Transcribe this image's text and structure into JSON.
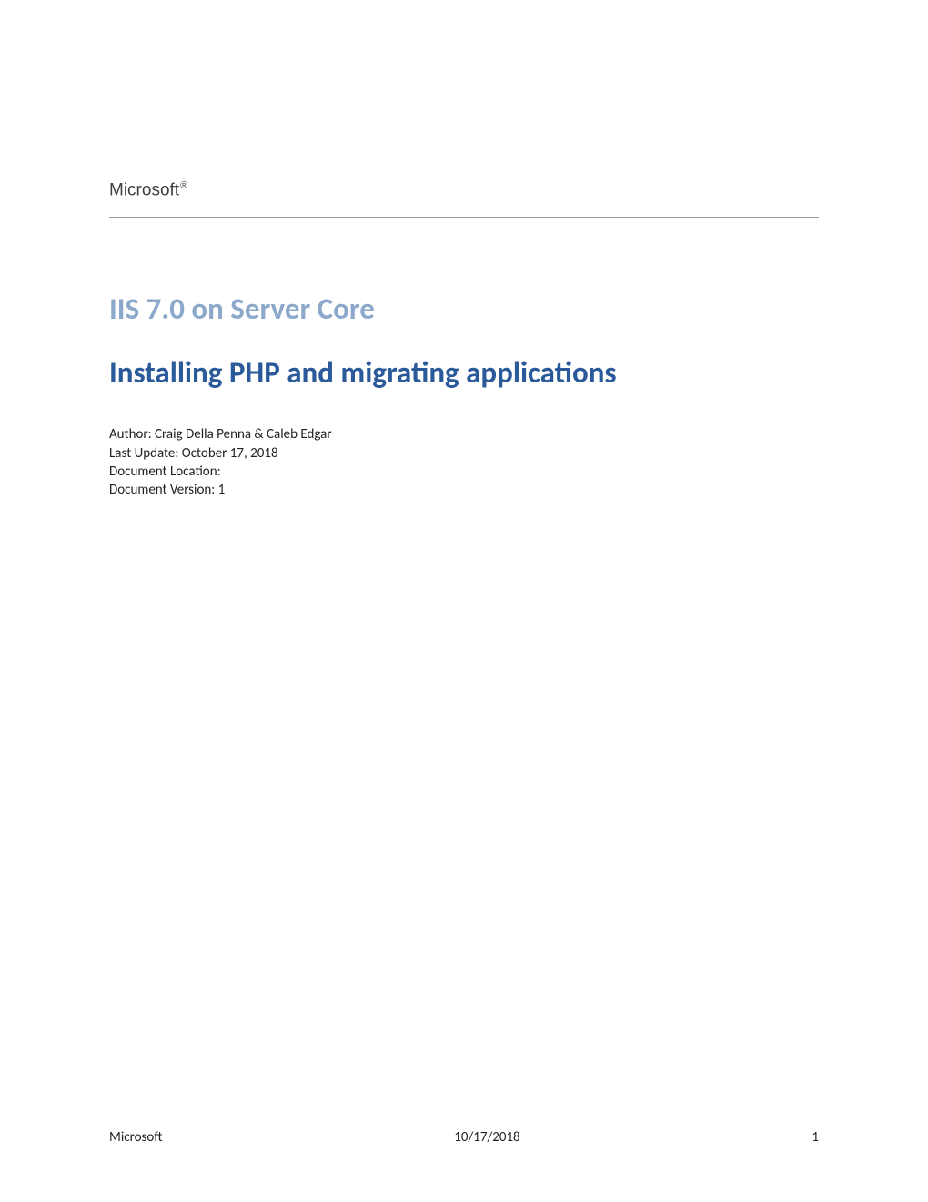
{
  "header": {
    "brand": "Microsoft",
    "registered": "®"
  },
  "titles": {
    "muted": "IIS 7.0 on Server Core",
    "main": "Installing PHP and migrating applications"
  },
  "meta": {
    "author_line": "Author: Craig Della Penna & Caleb Edgar",
    "last_update_line": "Last Update: October 17, 2018",
    "location_line": "Document Location:",
    "version_line": "Document Version: 1"
  },
  "footer": {
    "left": "Microsoft",
    "center": "10/17/2018",
    "right": "1"
  }
}
